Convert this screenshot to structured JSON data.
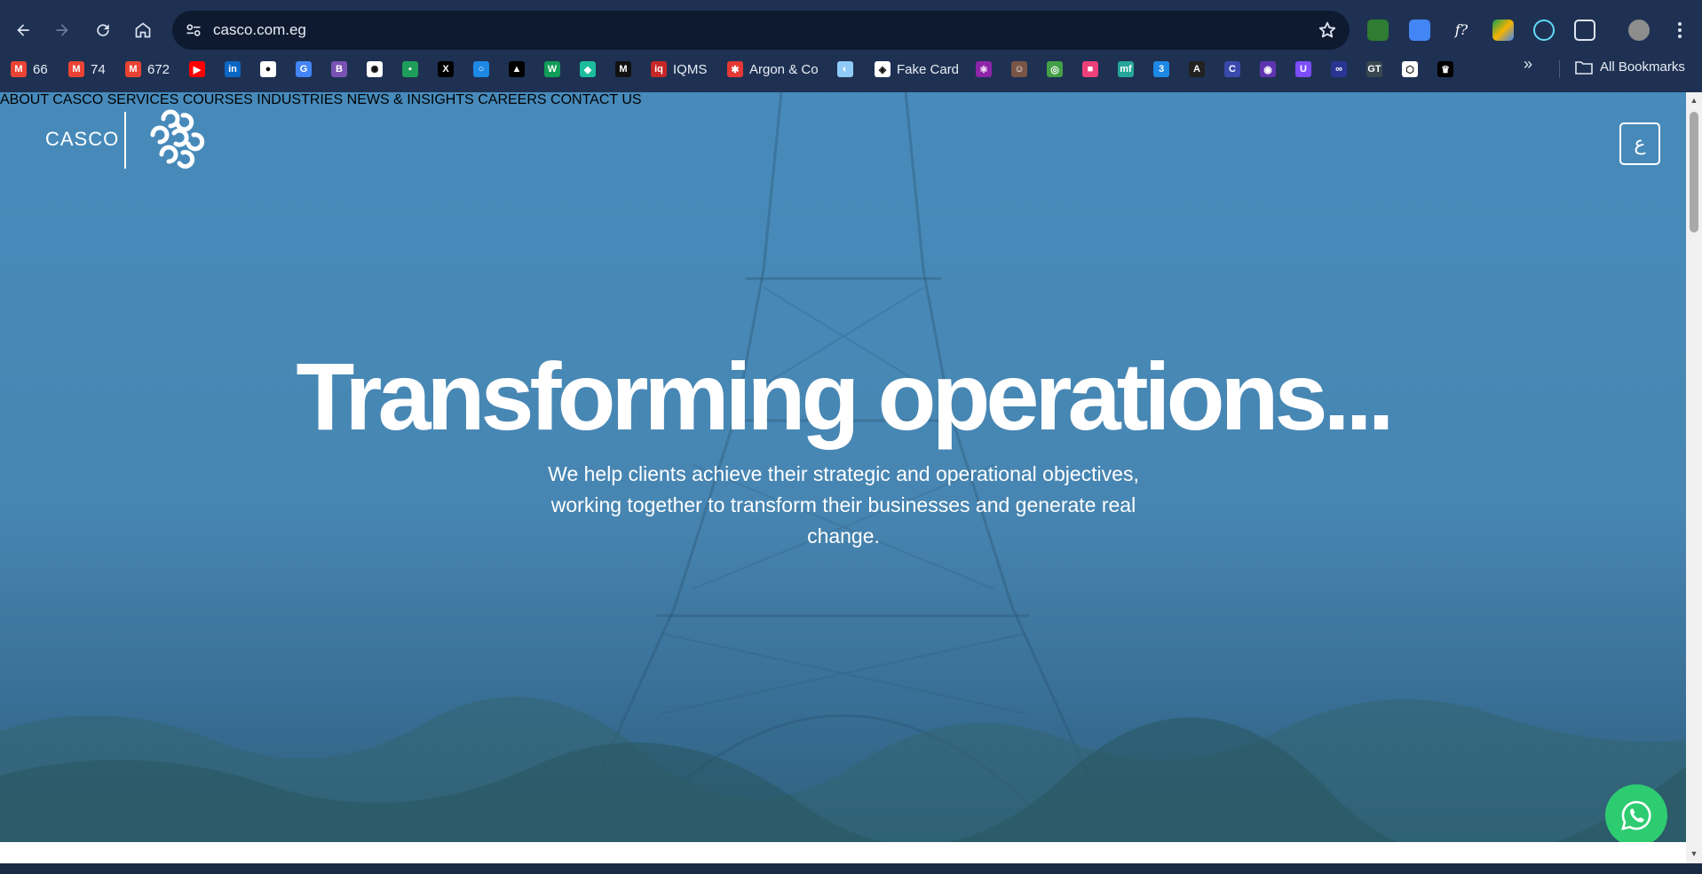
{
  "browser": {
    "url": "casco.com.eg",
    "bookmarks": [
      {
        "label": "66",
        "icon": "gmail-icon",
        "color": "#ea4335"
      },
      {
        "label": "74",
        "icon": "gmail-icon",
        "color": "#ea4335"
      },
      {
        "label": "672",
        "icon": "gmail-icon",
        "color": "#ea4335"
      },
      {
        "label": "",
        "icon": "youtube-icon",
        "color": "#ff0000"
      },
      {
        "label": "",
        "icon": "linkedin-icon",
        "color": "#0a66c2"
      },
      {
        "label": "",
        "icon": "github-icon",
        "color": "#ffffff"
      },
      {
        "label": "",
        "icon": "translate-icon",
        "color": "#4285f4"
      },
      {
        "label": "",
        "icon": "bootstrap-icon",
        "color": "#7952b3"
      },
      {
        "label": "",
        "icon": "chatgpt-icon",
        "color": "#ffffff"
      },
      {
        "label": "",
        "icon": "sheet-icon",
        "color": "#1e9e5a"
      },
      {
        "label": "",
        "icon": "x-icon",
        "color": "#000000"
      },
      {
        "label": "",
        "icon": "circle-icon",
        "color": "#1e88e5"
      },
      {
        "label": "",
        "icon": "triangle-icon",
        "color": "#000000"
      },
      {
        "label": "",
        "icon": "w-icon",
        "color": "#0f9d58"
      },
      {
        "label": "",
        "icon": "diamond-icon",
        "color": "#1abc9c"
      },
      {
        "label": "",
        "icon": "m-icon",
        "color": "#111111"
      },
      {
        "label": "IQMS",
        "icon": "iqms-icon",
        "color": "#c62828"
      },
      {
        "label": "Argon & Co",
        "icon": "argon-icon",
        "color": "#e53935"
      },
      {
        "label": "",
        "icon": "globe-icon",
        "color": "#90caf9"
      },
      {
        "label": "Fake Card",
        "icon": "card-icon",
        "color": "#ffffff"
      },
      {
        "label": "",
        "icon": "react-icon",
        "color": "#8e24aa"
      },
      {
        "label": "",
        "icon": "avatar-icon",
        "color": "#795548"
      },
      {
        "label": "",
        "icon": "ring-icon",
        "color": "#43a047"
      },
      {
        "label": "",
        "icon": "square-icon",
        "color": "#ec407a"
      },
      {
        "label": "",
        "icon": "mf-icon",
        "color": "#26a69a"
      },
      {
        "label": "",
        "icon": "css-icon",
        "color": "#1e88e5"
      },
      {
        "label": "",
        "icon": "a-icon",
        "color": "#212121"
      },
      {
        "label": "",
        "icon": "c-icon",
        "color": "#3949ab"
      },
      {
        "label": "",
        "icon": "dot-icon",
        "color": "#5e35b1"
      },
      {
        "label": "",
        "icon": "u-icon",
        "color": "#7c4dff"
      },
      {
        "label": "",
        "icon": "loop-icon",
        "color": "#283593"
      },
      {
        "label": "",
        "icon": "gt-icon",
        "color": "#37474f"
      },
      {
        "label": "",
        "icon": "codepen-icon",
        "color": "#ffffff"
      },
      {
        "label": "",
        "icon": "crown-icon",
        "color": "#000000"
      }
    ],
    "all_bookmarks_label": "All Bookmarks"
  },
  "site": {
    "logo_text": "CASCO",
    "nav": [
      {
        "label": "ABOUT CASCO"
      },
      {
        "label": "SERVICES"
      },
      {
        "label": "COURSES"
      },
      {
        "label": "INDUSTRIES"
      },
      {
        "label": "NEWS & INSIGHTS"
      },
      {
        "label": "CAREERS"
      },
      {
        "label": "CONTACT US"
      }
    ],
    "language_button": "ع",
    "headline": "Transforming operations...",
    "subheadline": "We help clients achieve their strategic and operational objectives, working together to transform their businesses and generate real change."
  },
  "colors": {
    "hero_overlay": "#4a92c4",
    "whatsapp": "#2ecc71",
    "chrome": "#1f3152"
  }
}
